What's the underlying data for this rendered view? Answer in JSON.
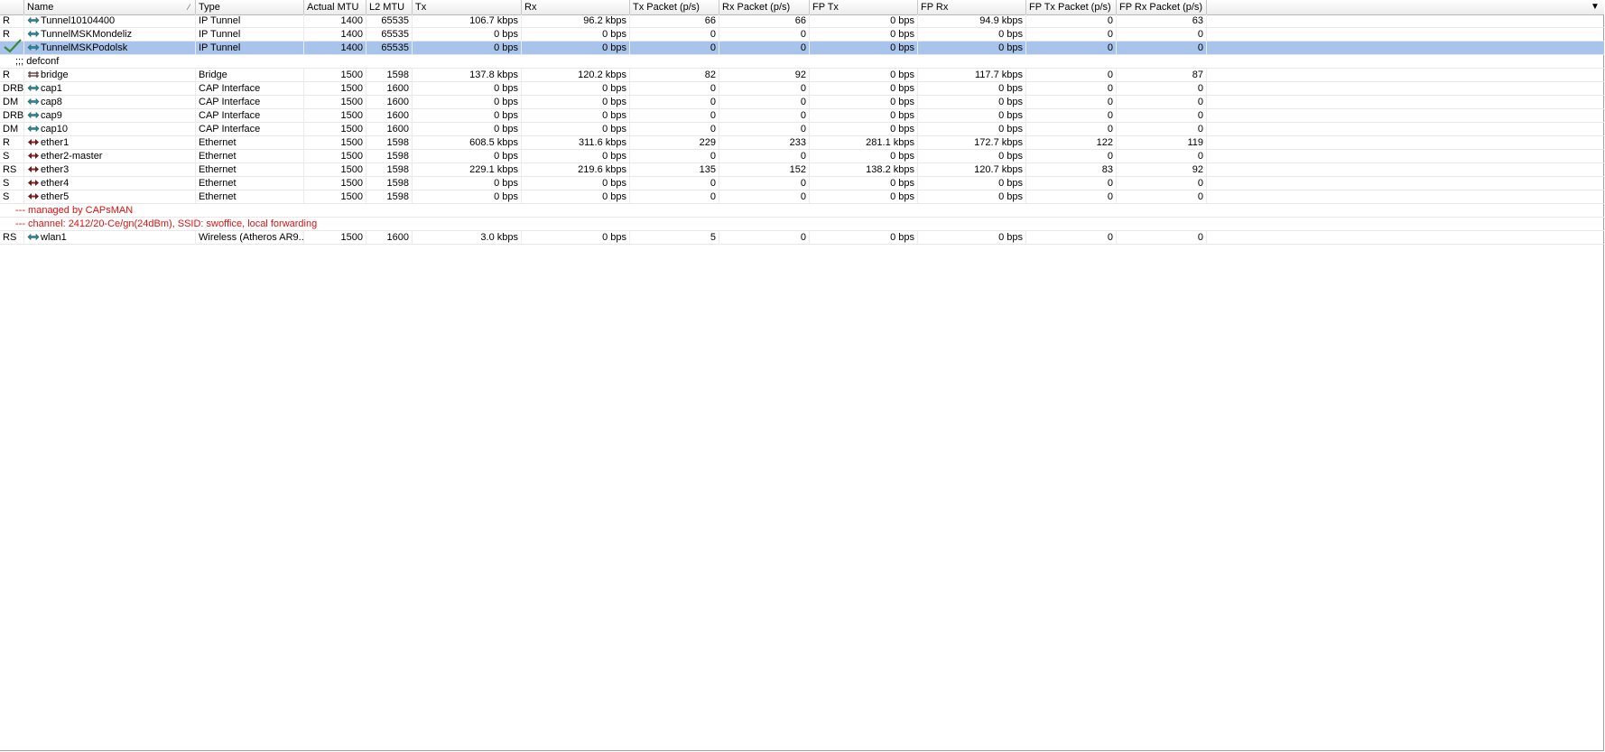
{
  "columns": [
    "",
    "Name",
    "Type",
    "Actual MTU",
    "L2 MTU",
    "Tx",
    "Rx",
    "Tx Packet (p/s)",
    "Rx Packet (p/s)",
    "FP Tx",
    "FP Rx",
    "FP Tx Packet (p/s)",
    "FP Rx Packet (p/s)"
  ],
  "rows": [
    {
      "kind": "row",
      "flags": "R",
      "icon": "tunnel-icon",
      "name": "Tunnel10104400",
      "type": "IP Tunnel",
      "mtu": "1400",
      "l2mtu": "65535",
      "tx": "106.7 kbps",
      "rx": "96.2 kbps",
      "txp": "66",
      "rxp": "66",
      "fptx": "0 bps",
      "fprx": "94.9 kbps",
      "fptxp": "0",
      "fprxp": "63"
    },
    {
      "kind": "row",
      "flags": "R",
      "icon": "tunnel-icon",
      "name": "TunnelMSKMondeliz",
      "type": "IP Tunnel",
      "mtu": "1400",
      "l2mtu": "65535",
      "tx": "0 bps",
      "rx": "0 bps",
      "txp": "0",
      "rxp": "0",
      "fptx": "0 bps",
      "fprx": "0 bps",
      "fptxp": "0",
      "fprxp": "0"
    },
    {
      "kind": "row",
      "flags": "",
      "icon": "tunnel-icon",
      "name": "TunnelMSKPodolsk",
      "type": "IP Tunnel",
      "mtu": "1400",
      "l2mtu": "65535",
      "tx": "0 bps",
      "rx": "0 bps",
      "txp": "0",
      "rxp": "0",
      "fptx": "0 bps",
      "fprx": "0 bps",
      "fptxp": "0",
      "fprxp": "0",
      "selected": true
    },
    {
      "kind": "comment",
      "text": ";;; defconf",
      "red": false
    },
    {
      "kind": "row",
      "flags": "R",
      "icon": "bridge-icon",
      "name": "bridge",
      "type": "Bridge",
      "mtu": "1500",
      "l2mtu": "1598",
      "tx": "137.8 kbps",
      "rx": "120.2 kbps",
      "txp": "82",
      "rxp": "92",
      "fptx": "0 bps",
      "fprx": "117.7 kbps",
      "fptxp": "0",
      "fprxp": "87"
    },
    {
      "kind": "row",
      "flags": "DRB",
      "icon": "cap-icon",
      "name": "cap1",
      "type": "CAP Interface",
      "mtu": "1500",
      "l2mtu": "1600",
      "tx": "0 bps",
      "rx": "0 bps",
      "txp": "0",
      "rxp": "0",
      "fptx": "0 bps",
      "fprx": "0 bps",
      "fptxp": "0",
      "fprxp": "0"
    },
    {
      "kind": "row",
      "flags": "DM",
      "icon": "cap-icon",
      "name": "cap8",
      "type": "CAP Interface",
      "mtu": "1500",
      "l2mtu": "1600",
      "tx": "0 bps",
      "rx": "0 bps",
      "txp": "0",
      "rxp": "0",
      "fptx": "0 bps",
      "fprx": "0 bps",
      "fptxp": "0",
      "fprxp": "0"
    },
    {
      "kind": "row",
      "flags": "DRB",
      "icon": "cap-icon",
      "name": "cap9",
      "type": "CAP Interface",
      "mtu": "1500",
      "l2mtu": "1600",
      "tx": "0 bps",
      "rx": "0 bps",
      "txp": "0",
      "rxp": "0",
      "fptx": "0 bps",
      "fprx": "0 bps",
      "fptxp": "0",
      "fprxp": "0"
    },
    {
      "kind": "row",
      "flags": "DM",
      "icon": "cap-icon",
      "name": "cap10",
      "type": "CAP Interface",
      "mtu": "1500",
      "l2mtu": "1600",
      "tx": "0 bps",
      "rx": "0 bps",
      "txp": "0",
      "rxp": "0",
      "fptx": "0 bps",
      "fprx": "0 bps",
      "fptxp": "0",
      "fprxp": "0"
    },
    {
      "kind": "row",
      "flags": "R",
      "icon": "ethernet-icon",
      "name": "ether1",
      "type": "Ethernet",
      "mtu": "1500",
      "l2mtu": "1598",
      "tx": "608.5 kbps",
      "rx": "311.6 kbps",
      "txp": "229",
      "rxp": "233",
      "fptx": "281.1 kbps",
      "fprx": "172.7 kbps",
      "fptxp": "122",
      "fprxp": "119"
    },
    {
      "kind": "row",
      "flags": "S",
      "icon": "ethernet-icon",
      "name": "ether2-master",
      "type": "Ethernet",
      "mtu": "1500",
      "l2mtu": "1598",
      "tx": "0 bps",
      "rx": "0 bps",
      "txp": "0",
      "rxp": "0",
      "fptx": "0 bps",
      "fprx": "0 bps",
      "fptxp": "0",
      "fprxp": "0"
    },
    {
      "kind": "row",
      "flags": "RS",
      "icon": "ethernet-icon",
      "name": "ether3",
      "type": "Ethernet",
      "mtu": "1500",
      "l2mtu": "1598",
      "tx": "229.1 kbps",
      "rx": "219.6 kbps",
      "txp": "135",
      "rxp": "152",
      "fptx": "138.2 kbps",
      "fprx": "120.7 kbps",
      "fptxp": "83",
      "fprxp": "92"
    },
    {
      "kind": "row",
      "flags": "S",
      "icon": "ethernet-icon",
      "name": "ether4",
      "type": "Ethernet",
      "mtu": "1500",
      "l2mtu": "1598",
      "tx": "0 bps",
      "rx": "0 bps",
      "txp": "0",
      "rxp": "0",
      "fptx": "0 bps",
      "fprx": "0 bps",
      "fptxp": "0",
      "fprxp": "0"
    },
    {
      "kind": "row",
      "flags": "S",
      "icon": "ethernet-icon",
      "name": "ether5",
      "type": "Ethernet",
      "mtu": "1500",
      "l2mtu": "1598",
      "tx": "0 bps",
      "rx": "0 bps",
      "txp": "0",
      "rxp": "0",
      "fptx": "0 bps",
      "fprx": "0 bps",
      "fptxp": "0",
      "fprxp": "0"
    },
    {
      "kind": "comment",
      "text": "--- managed by CAPsMAN",
      "red": true
    },
    {
      "kind": "comment",
      "text": "--- channel: 2412/20-Ce/gn(24dBm), SSID: swoffice, local forwarding",
      "red": true
    },
    {
      "kind": "row",
      "flags": "RS",
      "icon": "wireless-icon",
      "name": "wlan1",
      "type": "Wireless (Atheros AR9...",
      "mtu": "1500",
      "l2mtu": "1600",
      "tx": "3.0 kbps",
      "rx": "0 bps",
      "txp": "5",
      "rxp": "0",
      "fptx": "0 bps",
      "fprx": "0 bps",
      "fptxp": "0",
      "fprxp": "0"
    }
  ],
  "colors": {
    "selected": "#a8c4ea",
    "comment_red": "#e01010",
    "grid": "#e8e8e8"
  }
}
